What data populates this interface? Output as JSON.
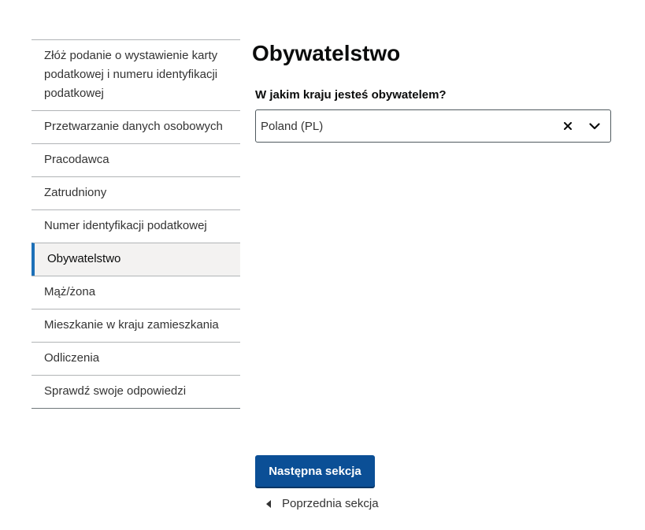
{
  "sidebar": {
    "items": [
      {
        "label": "Złóż podanie o wystawienie karty podatkowej i numeru identyfikacji podatkowej"
      },
      {
        "label": "Przetwarzanie danych osobowych"
      },
      {
        "label": "Pracodawca"
      },
      {
        "label": "Zatrudniony"
      },
      {
        "label": "Numer identyfikacji podatkowej"
      },
      {
        "label": "Obywatelstwo"
      },
      {
        "label": "Mąż/żona"
      },
      {
        "label": "Mieszkanie w kraju zamieszkania"
      },
      {
        "label": "Odliczenia"
      },
      {
        "label": "Sprawdź swoje odpowiedzi"
      }
    ],
    "active_index": 5
  },
  "main": {
    "title": "Obywatelstwo",
    "question": "W jakim kraju jesteś obywatelem?",
    "select": {
      "value": "Poland (PL)",
      "clear_icon": "close-icon",
      "expand_icon": "chevron-down-icon"
    }
  },
  "actions": {
    "next_label": "Następna sekcja",
    "prev_label": "Poprzednia sekcja"
  },
  "colors": {
    "primary": "#0b4f96",
    "active_border": "#1d70b8"
  }
}
